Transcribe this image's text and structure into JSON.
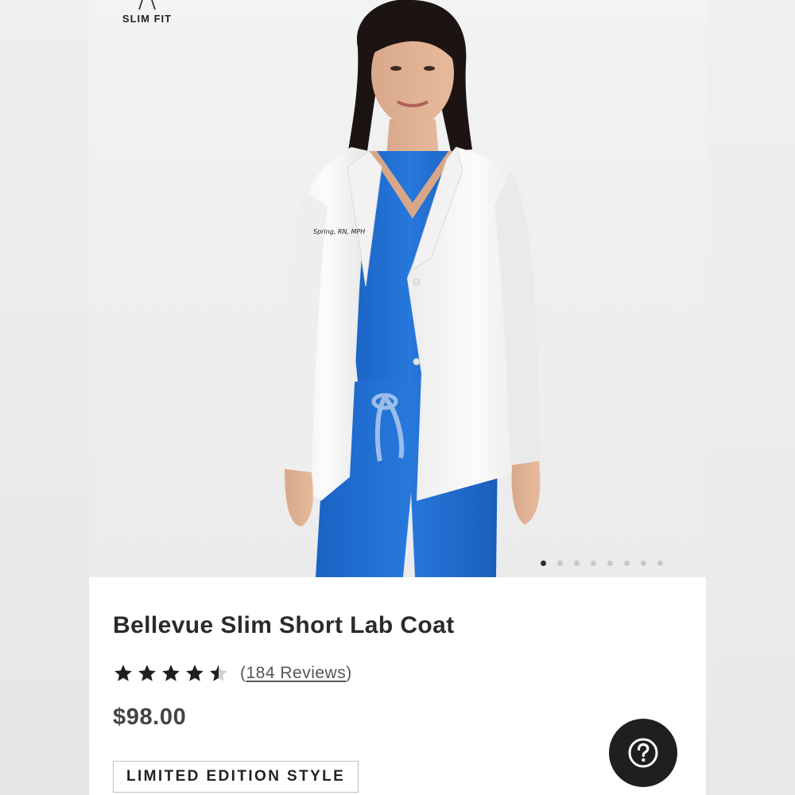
{
  "fit": {
    "label": "SLIM FIT",
    "icon": "fit-silhouette-icon"
  },
  "gallery": {
    "image_alt": "Woman wearing a white lab coat over royal blue scrubs",
    "embroidery": "Spring, RN, MPH",
    "total_slides": 8,
    "active_slide": 1
  },
  "product": {
    "title": "Bellevue Slim Short Lab Coat",
    "rating": 4.5,
    "reviews_open": "(",
    "reviews_link": "184 Reviews",
    "reviews_close": ")",
    "price": "$98.00",
    "badge": "LIMITED EDITION STYLE"
  },
  "help": {
    "icon": "question-mark-icon"
  },
  "colors": {
    "scrub_blue": "#1f6fd1",
    "coat_white": "#f7f7f7",
    "text_dark": "#2a2a2a",
    "help_button_bg": "#1f1f1f"
  }
}
